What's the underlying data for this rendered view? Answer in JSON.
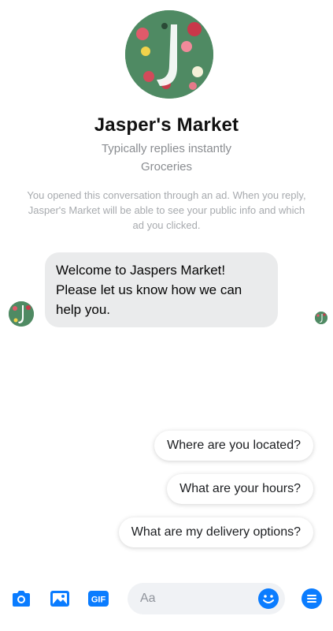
{
  "header": {
    "page_name": "Jasper's Market",
    "response_time": "Typically replies instantly",
    "category": "Groceries",
    "ad_notice": "You opened this conversation through an ad. When you reply, Jasper's Market will be able to see your public info and which ad you clicked."
  },
  "conversation": {
    "messages": [
      {
        "text": "Welcome to Jaspers Market! Please let us know how we can help you."
      }
    ]
  },
  "quick_replies": [
    "Where are you located?",
    "What are your hours?",
    "What are my delivery options?"
  ],
  "composer": {
    "placeholder": "Aa",
    "gif_label": "GIF",
    "icons": [
      "camera-icon",
      "photo-icon",
      "gif-icon",
      "emoji-icon",
      "menu-icon"
    ]
  },
  "colors": {
    "accent": "#0a7cff",
    "bubble": "#eaebec",
    "avatar_green": "#4f8a63"
  }
}
